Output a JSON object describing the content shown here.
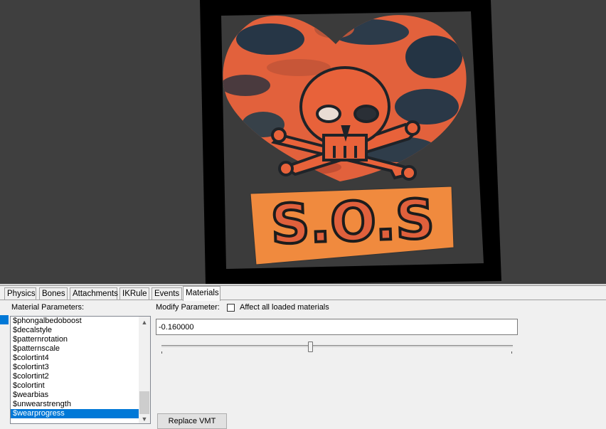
{
  "tabs": {
    "physics": "Physics",
    "bones": "Bones",
    "attachments": "Attachments",
    "ikrule": "IKRule",
    "events": "Events",
    "materials": "Materials",
    "active": "Materials"
  },
  "materials_panel": {
    "params_label": "Material Parameters:",
    "modify_label": "Modify Parameter:",
    "affect_all_label": "Affect all loaded materials",
    "affect_all_checked": false,
    "value": "-0.160000",
    "replace_button": "Replace VMT",
    "parameters": [
      "$phongalbedoboost",
      "$decalstyle",
      "$patternrotation",
      "$patternscale",
      "$colortint4",
      "$colortint3",
      "$colortint2",
      "$colortint",
      "$wearbias",
      "$unwearstrength",
      "$wearprogress"
    ],
    "selected_parameter": "$wearprogress"
  },
  "viewport": {
    "sticker_text": "S.O.S",
    "background_color": "#3f3f3f",
    "accent_color": "#e8623a"
  },
  "icons": {
    "list_up": "scroll-up-arrow",
    "list_down": "scroll-down-arrow"
  }
}
